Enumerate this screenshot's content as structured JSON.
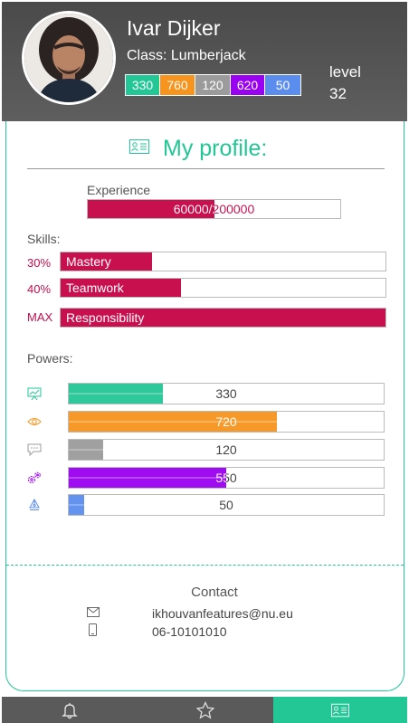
{
  "profile": {
    "name": "Ivar Dijker",
    "class": "Class: Lumberjack",
    "level_label": "level",
    "level_value": "32",
    "stats": [
      {
        "value": "330",
        "color": "#23c695"
      },
      {
        "value": "760",
        "color": "#f7941d"
      },
      {
        "value": "120",
        "color": "#9b9b9b"
      },
      {
        "value": "620",
        "color": "#9a00f2"
      },
      {
        "value": "50",
        "color": "#5b8def"
      }
    ]
  },
  "page": {
    "title": "My profile:",
    "title_icon": "id-card-icon",
    "accent": "#23c695"
  },
  "experience": {
    "label": "Experience",
    "text": "60000/200000",
    "progress": 0.5,
    "color": "#c8104f"
  },
  "skills": {
    "label": "Skills:",
    "items": [
      {
        "pct": "30%",
        "name": "Mastery",
        "progress": 0.28
      },
      {
        "pct": "40%",
        "name": "Teamwork",
        "progress": 0.37
      },
      {
        "pct": "MAX",
        "name": "Responsibility",
        "progress": 1.0
      }
    ],
    "color": "#c8104f"
  },
  "powers": {
    "label": "Powers:",
    "items": [
      {
        "icon": "presentation-icon",
        "value": "330",
        "progress": 0.3,
        "color": "#23c695"
      },
      {
        "icon": "eye-icon",
        "value": "720",
        "progress": 0.66,
        "color": "#f7941d"
      },
      {
        "icon": "chat-icon",
        "value": "120",
        "progress": 0.11,
        "color": "#9b9b9b"
      },
      {
        "icon": "gears-icon",
        "value": "550",
        "progress": 0.5,
        "color": "#9a00f2"
      },
      {
        "icon": "pen-icon",
        "value": "50",
        "progress": 0.05,
        "color": "#5b8def"
      }
    ]
  },
  "contact": {
    "title": "Contact",
    "email": "ikhouvanfeatures@nu.eu",
    "phone": "06-10101010"
  },
  "nav": {
    "items": [
      {
        "icon": "bell-icon",
        "active": false
      },
      {
        "icon": "star-icon",
        "active": false
      },
      {
        "icon": "id-card-icon",
        "active": true
      }
    ]
  }
}
